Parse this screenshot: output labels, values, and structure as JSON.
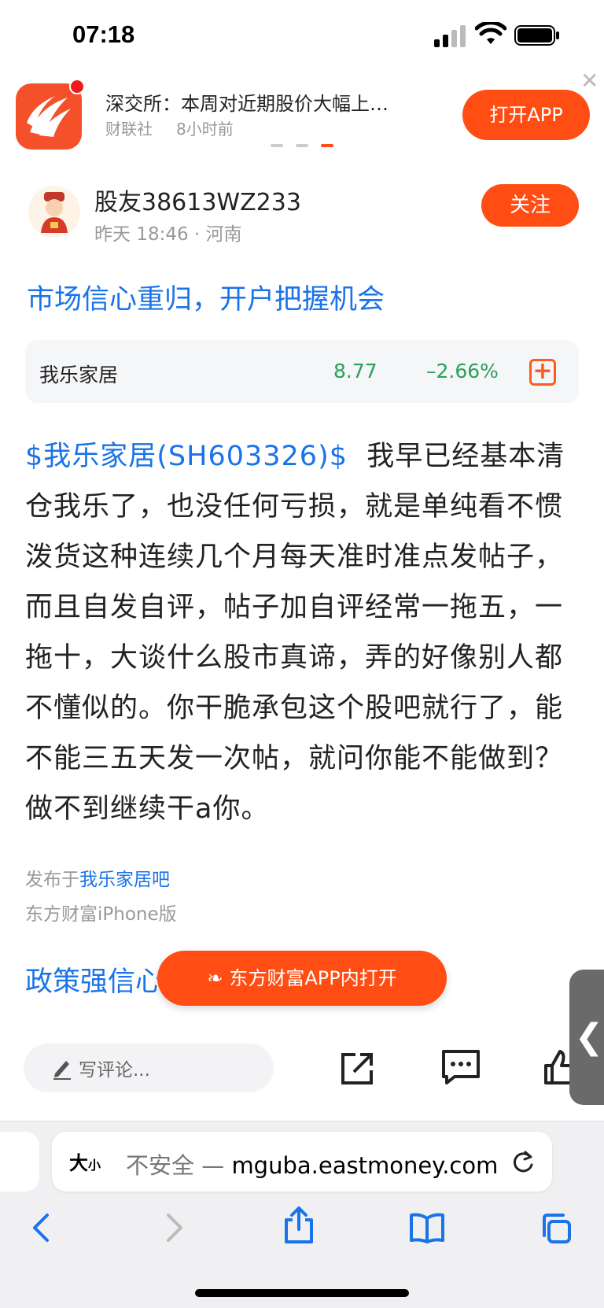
{
  "status_bar": {
    "time": "07:18"
  },
  "banner": {
    "headline": "深交所：本周对近期股价大幅上…",
    "source": "财联社",
    "time_ago": "8小时前",
    "open_app_label": "打开APP",
    "close_icon": "close-icon"
  },
  "author": {
    "name": "股友38613WZ233",
    "meta": "昨天 18:46 · 河南",
    "follow_label": "关注"
  },
  "post": {
    "title": "市场信心重归，开户把握机会",
    "stock": {
      "name": "我乐家居",
      "price": "8.77",
      "change": "–2.66%"
    },
    "cashtag": "$我乐家居(SH603326)$",
    "body": "我早已经基本清仓我乐了，也没任何亏损，就是单纯看不惯泼货这种连续几个月每天准时准点发帖子，而且自发自评，帖子加自评经常一拖五，一拖十，大谈什么股市真谛，弄的好像别人都不懂似的。你干脆承包这个股吧就行了，能不能三五天发一次帖，就问你能不能做到？做不到继续干a你。",
    "published_prefix": "发布于",
    "published_bar": "我乐家居吧",
    "device": "东方财富iPhone版"
  },
  "next_post": {
    "title": "政策强信心 望了，开个户先"
  },
  "float_button": {
    "label": "东方财富APP内打开"
  },
  "action_bar": {
    "comment_placeholder": "写评论..."
  },
  "safari": {
    "text_size_label": "大",
    "text_size_small": "小",
    "insecure_label": "不安全 —",
    "domain": "mguba.eastmoney.com"
  },
  "colors": {
    "brand": "#ff4d14",
    "link": "#1a73e8",
    "down": "#2aa05a"
  }
}
